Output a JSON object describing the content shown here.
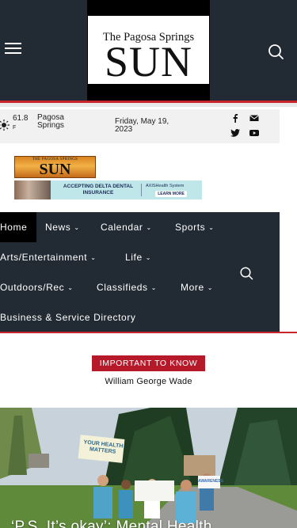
{
  "header": {
    "logo_top": "The Pagosa Springs",
    "logo_main": "SUN"
  },
  "infobar": {
    "temperature": "61.8",
    "temperature_unit": "F",
    "location": "Pagosa Springs",
    "date": "Friday, May 19, 2023"
  },
  "banner": {
    "logo_top": "THE PAGOSA SPRINGS",
    "logo_main": "SUN"
  },
  "ad": {
    "headline": "ACCEPTING DELTA DENTAL INSURANCE",
    "brand": "AXISHealth System",
    "button": "LEARN MORE"
  },
  "nav": {
    "items": [
      {
        "label": "Home",
        "has_dropdown": false
      },
      {
        "label": "News",
        "has_dropdown": true
      },
      {
        "label": "Calendar",
        "has_dropdown": true
      },
      {
        "label": "Sports",
        "has_dropdown": true
      },
      {
        "label": "Arts/Entertainment",
        "has_dropdown": true
      },
      {
        "label": "Life",
        "has_dropdown": true
      },
      {
        "label": "Outdoors/Rec",
        "has_dropdown": true
      },
      {
        "label": "Classifieds",
        "has_dropdown": true
      },
      {
        "label": "More",
        "has_dropdown": true
      },
      {
        "label": "Business & Service Directory",
        "has_dropdown": false
      }
    ],
    "chevron": "⌄"
  },
  "article": {
    "category": "IMPORTANT TO KNOW",
    "author": "William George Wade",
    "title": "‘P.S. It’s okay’: Mental Health",
    "sign_left": "YOUR HEALTH MATTERS",
    "sign_right": "AWARENESS"
  },
  "colors": {
    "header_bg": "#222b33",
    "accent_red": "#c9252c",
    "tag_red": "#b5192a"
  },
  "icons": {
    "menu": "hamburger-icon",
    "search": "search-icon",
    "weather": "sun-icon",
    "facebook": "facebook-icon",
    "email": "mail-icon",
    "twitter": "twitter-icon",
    "youtube": "youtube-icon"
  }
}
